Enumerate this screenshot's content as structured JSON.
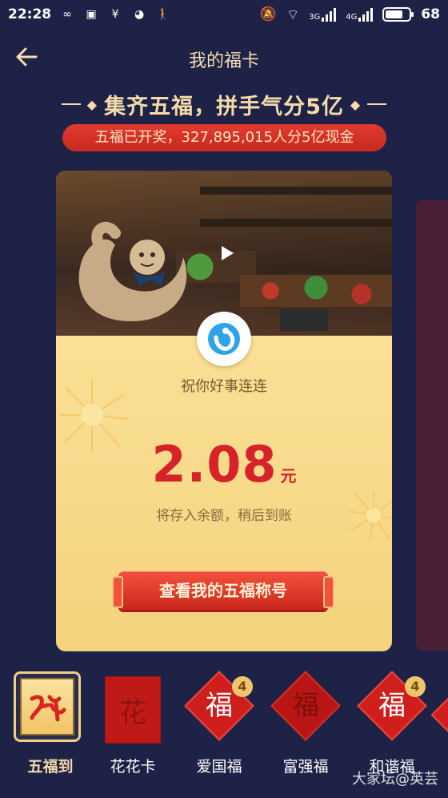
{
  "status_bar": {
    "time": "22:28",
    "battery": "68",
    "net_a": "3G",
    "net_b": "4G"
  },
  "header": {
    "title": "我的福卡"
  },
  "banner": {
    "slogan": "集齐五福，拼手气分5亿",
    "prize_info": "五福已开奖，327,895,015人分5亿现金"
  },
  "card": {
    "wish": "祝你好事连连",
    "amount": "2.08",
    "unit": "元",
    "note": "将存入余额，稍后到账",
    "button_label": "查看我的五福称号"
  },
  "fu_cards": [
    {
      "label": "五福到",
      "glyph": "",
      "badge": ""
    },
    {
      "label": "花花卡",
      "glyph": "花",
      "badge": ""
    },
    {
      "label": "爱国福",
      "glyph": "福",
      "badge": "4"
    },
    {
      "label": "富强福",
      "glyph": "福",
      "badge": ""
    },
    {
      "label": "和谐福",
      "glyph": "福",
      "badge": "4"
    }
  ],
  "watermark": "大家坛@英芸",
  "colors": {
    "background": "#1f2247",
    "accent_gold": "#f4dca8",
    "accent_red": "#d6232a",
    "card_yellow": "#fce59f"
  }
}
